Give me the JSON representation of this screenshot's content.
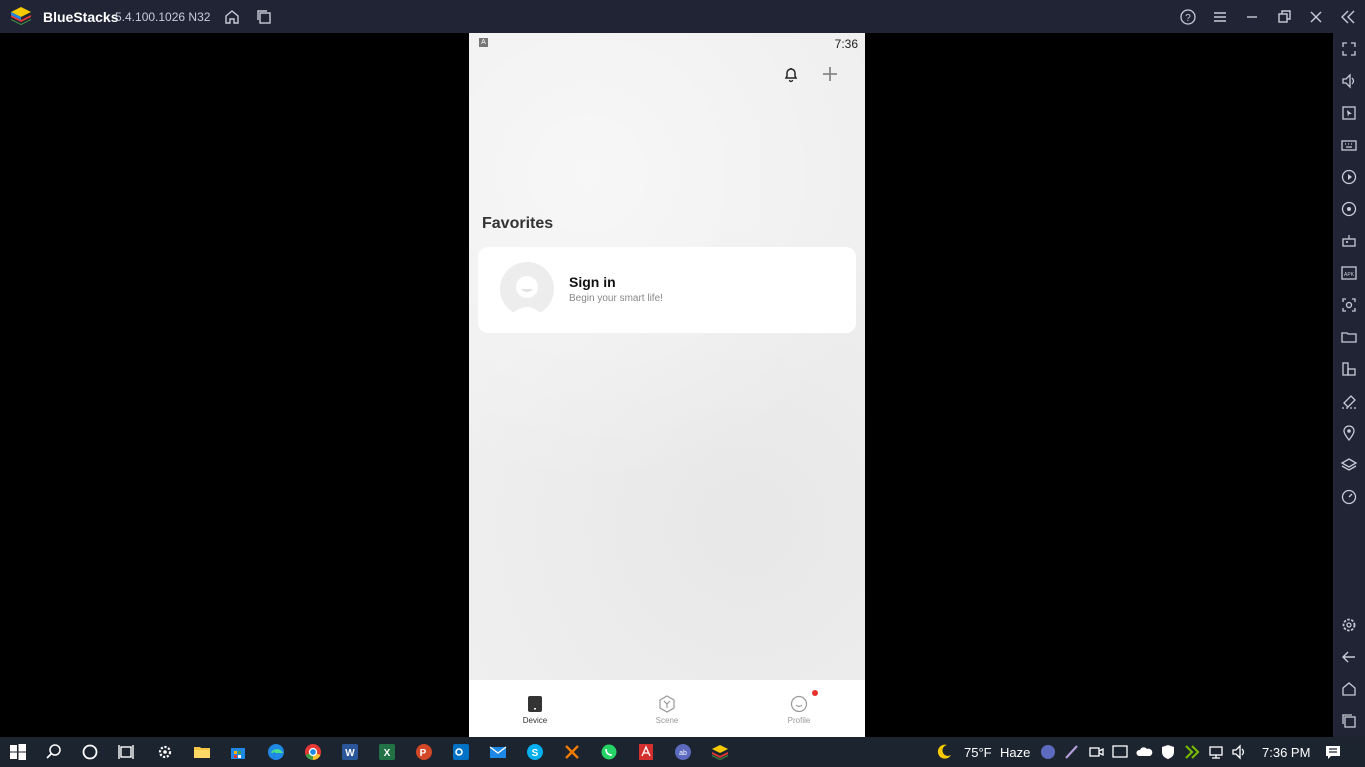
{
  "window": {
    "app_name": "BlueStacks",
    "version": "5.4.100.1026  N32"
  },
  "phone": {
    "status_time": "7:36",
    "status_icon": "A",
    "section_title": "Favorites",
    "signin_title": "Sign in",
    "signin_subtitle": "Begin your smart life!",
    "nav": [
      {
        "label": "Device",
        "active": true
      },
      {
        "label": "Scene",
        "active": false
      },
      {
        "label": "Profile",
        "active": false
      }
    ]
  },
  "taskbar": {
    "weather_temp": "75°F",
    "weather_text": "Haze",
    "clock": "7:36 PM"
  },
  "icons": {
    "titlebar": [
      "home-icon",
      "multi-instance-icon",
      "help-icon",
      "menu-icon",
      "minimize-icon",
      "restore-icon",
      "close-icon",
      "collapse-icon"
    ],
    "sidebar": [
      "fullscreen-icon",
      "volume-icon",
      "pointer-icon",
      "keyboard-icon",
      "macro-icon",
      "rotate-icon",
      "gamepad-icon",
      "apk-icon",
      "screenshot-icon",
      "folder-icon",
      "resize-icon",
      "erase-icon",
      "location-icon",
      "layers-icon",
      "speed-icon",
      "settings-icon",
      "back-icon",
      "home-icon",
      "recents-icon"
    ]
  }
}
